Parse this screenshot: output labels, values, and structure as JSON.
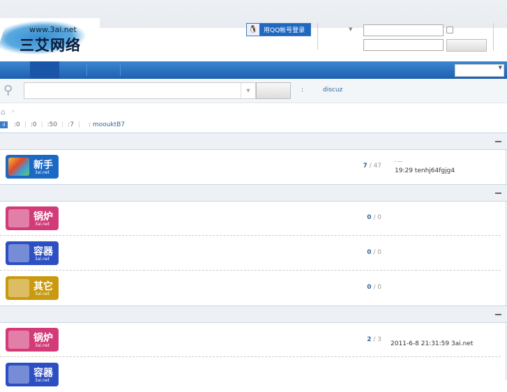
{
  "logo": {
    "url": "www.3ai.net",
    "name": "三艾网络"
  },
  "header": {
    "qq_login": "用QQ帐号登录"
  },
  "search": {
    "hot_label": ":",
    "hot_link": "discuz"
  },
  "breadcrumb": {
    "sep": "›"
  },
  "stats": {
    "items": [
      ":0",
      ":0",
      ":50",
      ":7"
    ],
    "newest_label": ":",
    "newest_member": "moouktB7"
  },
  "categories": [
    {
      "forums": [
        {
          "name": "新手",
          "sub": "3ai.net",
          "color": "#1c69c4",
          "today": "7",
          "total": "47",
          "last_title": ". ...",
          "last_post": "19:29 tenhj64fgjg4"
        }
      ]
    },
    {
      "forums": [
        {
          "name": "锅炉",
          "sub": "3ai.net",
          "color": "#d33b78",
          "today": "0",
          "total": "0",
          "last_post": ""
        },
        {
          "name": "容器",
          "sub": "3ai.net",
          "color": "#2d4fc2",
          "today": "0",
          "total": "0",
          "last_post": ""
        },
        {
          "name": "其它",
          "sub": "3ai.net",
          "color": "#c99a10",
          "today": "0",
          "total": "0",
          "last_post": ""
        }
      ]
    },
    {
      "forums": [
        {
          "name": "锅炉",
          "sub": "3ai.net",
          "color": "#d33b78",
          "today": "2",
          "total": "3",
          "last_post": "2011-6-8 21:31:59 3ai.net"
        },
        {
          "name": "容器",
          "sub": "3ai.net",
          "color": "#2d4fc2",
          "today": "",
          "total": "",
          "last_post": ""
        }
      ]
    }
  ]
}
